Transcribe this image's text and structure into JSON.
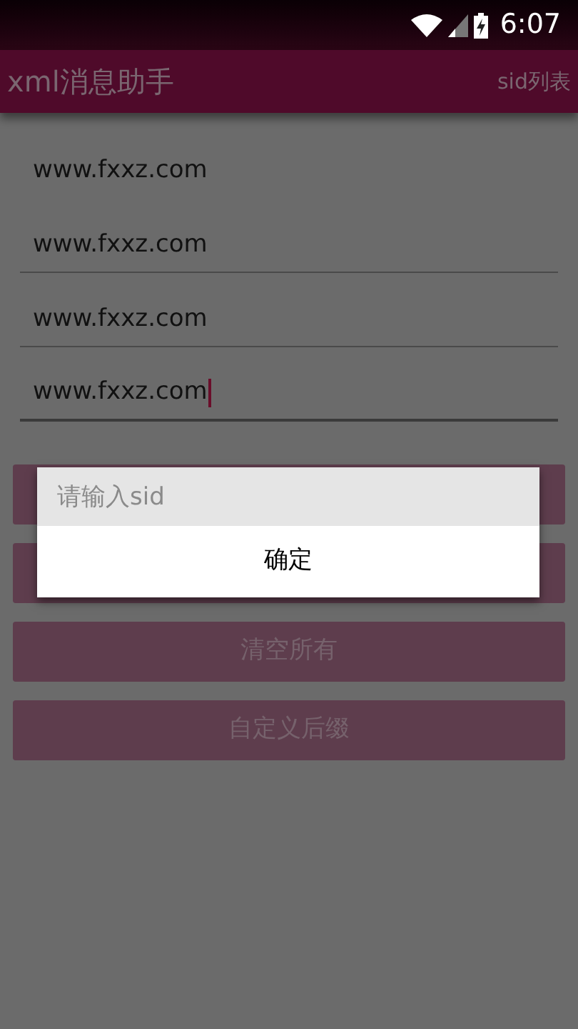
{
  "status_bar": {
    "time": "6:07"
  },
  "app_bar": {
    "title": "xml消息助手",
    "action": "sid列表"
  },
  "fields": [
    {
      "kind": "text",
      "value": "www.fxxz.com",
      "focused": false
    },
    {
      "kind": "input",
      "value": "www.fxxz.com",
      "focused": false
    },
    {
      "kind": "input",
      "value": "www.fxxz.com",
      "focused": false
    },
    {
      "kind": "input",
      "value": "www.fxxz.com",
      "focused": true
    }
  ],
  "buttons": [
    {
      "kind": "covered"
    },
    {
      "kind": "covered"
    },
    {
      "kind": "labeled",
      "label": "清空所有"
    },
    {
      "kind": "labeled",
      "label": "自定义后缀"
    }
  ],
  "dialog": {
    "placeholder": "请输入sid",
    "button": "确定"
  }
}
